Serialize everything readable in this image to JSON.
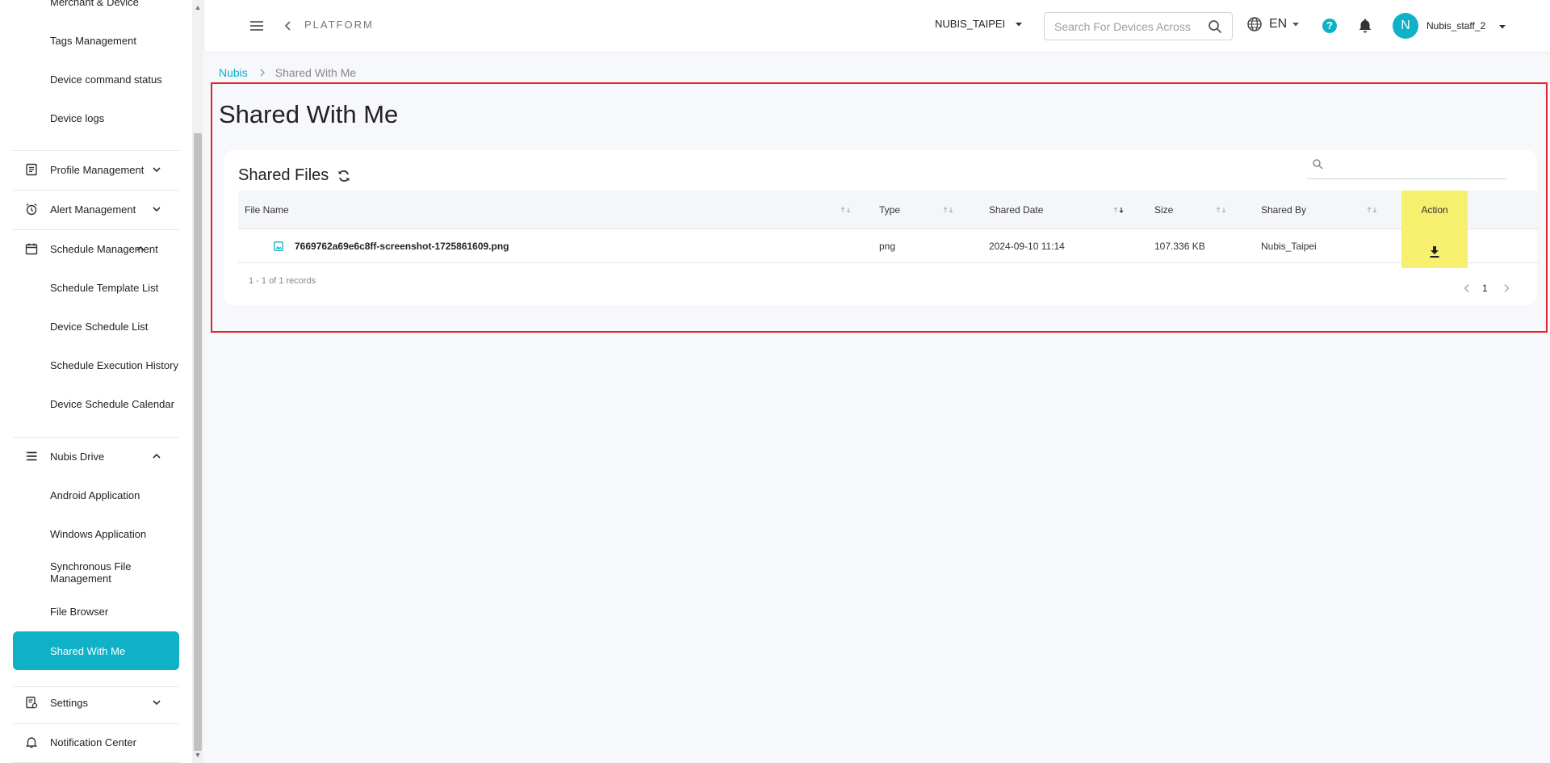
{
  "sidebar": {
    "items": [
      {
        "label": "Merchant & Device"
      },
      {
        "label": "Tags Management"
      },
      {
        "label": "Device command status"
      },
      {
        "label": "Device logs"
      },
      {
        "label": "Profile Management"
      },
      {
        "label": "Alert Management"
      },
      {
        "label": "Schedule Management"
      },
      {
        "label": "Schedule Template List"
      },
      {
        "label": "Device Schedule List"
      },
      {
        "label": "Schedule Execution History"
      },
      {
        "label": "Device Schedule Calendar"
      },
      {
        "label": "Nubis Drive"
      },
      {
        "label": "Android Application"
      },
      {
        "label": "Windows Application"
      },
      {
        "label": "Synchronous File Management"
      },
      {
        "label": "File Browser"
      },
      {
        "label": "Shared With Me"
      },
      {
        "label": "Settings"
      },
      {
        "label": "Notification Center"
      }
    ],
    "active_item": "Shared With Me",
    "accent_color": "#0fb1c9"
  },
  "topbar": {
    "platform_label": "PLATFORM",
    "tenant": "NUBIS_TAIPEI",
    "search_placeholder": "Search For Devices Across",
    "language": "EN",
    "help_label": "?",
    "avatar_initial": "N",
    "username": "Nubis_staff_2"
  },
  "breadcrumb": {
    "root": "Nubis",
    "current": "Shared With Me"
  },
  "page": {
    "title": "Shared With Me"
  },
  "card": {
    "title": "Shared Files",
    "search_value": "",
    "columns": [
      "File Name",
      "Type",
      "Shared Date",
      "Size",
      "Shared By",
      "Action"
    ],
    "rows": [
      {
        "file_name": "7669762a69e6c8ff-screenshot-1725861609.png",
        "type": "png",
        "shared_date": "2024-09-10 11:14",
        "size": "107.336 KB",
        "shared_by": "Nubis_Taipei"
      }
    ],
    "records_text": "1 - 1 of 1 records",
    "current_page": "1"
  },
  "colors": {
    "accent": "#0fb1c9",
    "highlight": "#f7ef6e",
    "annotation_frame": "#e2232a"
  }
}
